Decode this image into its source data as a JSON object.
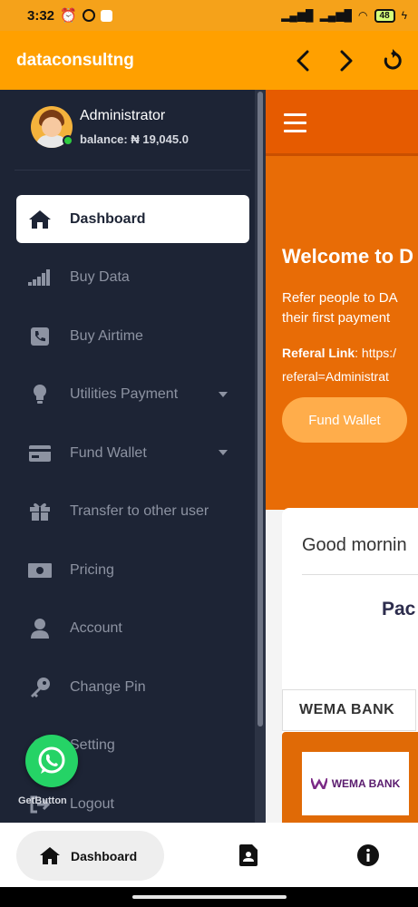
{
  "status_bar": {
    "time": "3:32",
    "battery": "48"
  },
  "app_bar": {
    "title": "dataconsultng"
  },
  "drawer": {
    "profile": {
      "name": "Administrator",
      "balance": "balance: ₦ 19,045.0"
    },
    "menu": [
      {
        "label": "Dashboard",
        "icon": "home-icon",
        "active": true
      },
      {
        "label": "Buy Data",
        "icon": "signal-bars-icon"
      },
      {
        "label": "Buy Airtime",
        "icon": "phone-square-icon"
      },
      {
        "label": "Utilities Payment",
        "icon": "lightbulb-icon",
        "has_submenu": true
      },
      {
        "label": "Fund Wallet",
        "icon": "credit-card-icon",
        "has_submenu": true
      },
      {
        "label": "Transfer to other user",
        "icon": "gift-icon"
      },
      {
        "label": "Pricing",
        "icon": "money-bill-icon"
      },
      {
        "label": "Account",
        "icon": "user-icon"
      },
      {
        "label": "Change Pin",
        "icon": "key-icon"
      },
      {
        "label": "Setting",
        "icon": "gear-icon"
      },
      {
        "label": "Logout",
        "icon": "logout-icon"
      }
    ]
  },
  "content": {
    "welcome": "Welcome to D",
    "refer_line1": "Refer people to DA",
    "refer_line2": "their first payment",
    "referal_label": "Referal Link",
    "referal_value": ": https:/",
    "referal_param": "referal=Administrat",
    "fund_wallet_button": "Fund Wallet",
    "greeting": "Good mornin",
    "packages_heading": "Pac",
    "bank_tab": "WEMA BANK",
    "bank_logo_text": "WEMA BANK"
  },
  "floating": {
    "getbutton_label": "GetButton"
  },
  "bottom_nav": {
    "dashboard_label": "Dashboard"
  },
  "colors": {
    "app_bar": "#ffa000",
    "drawer_bg": "#1d2435",
    "hero_bg": "#e86c06",
    "whatsapp": "#25d366"
  }
}
